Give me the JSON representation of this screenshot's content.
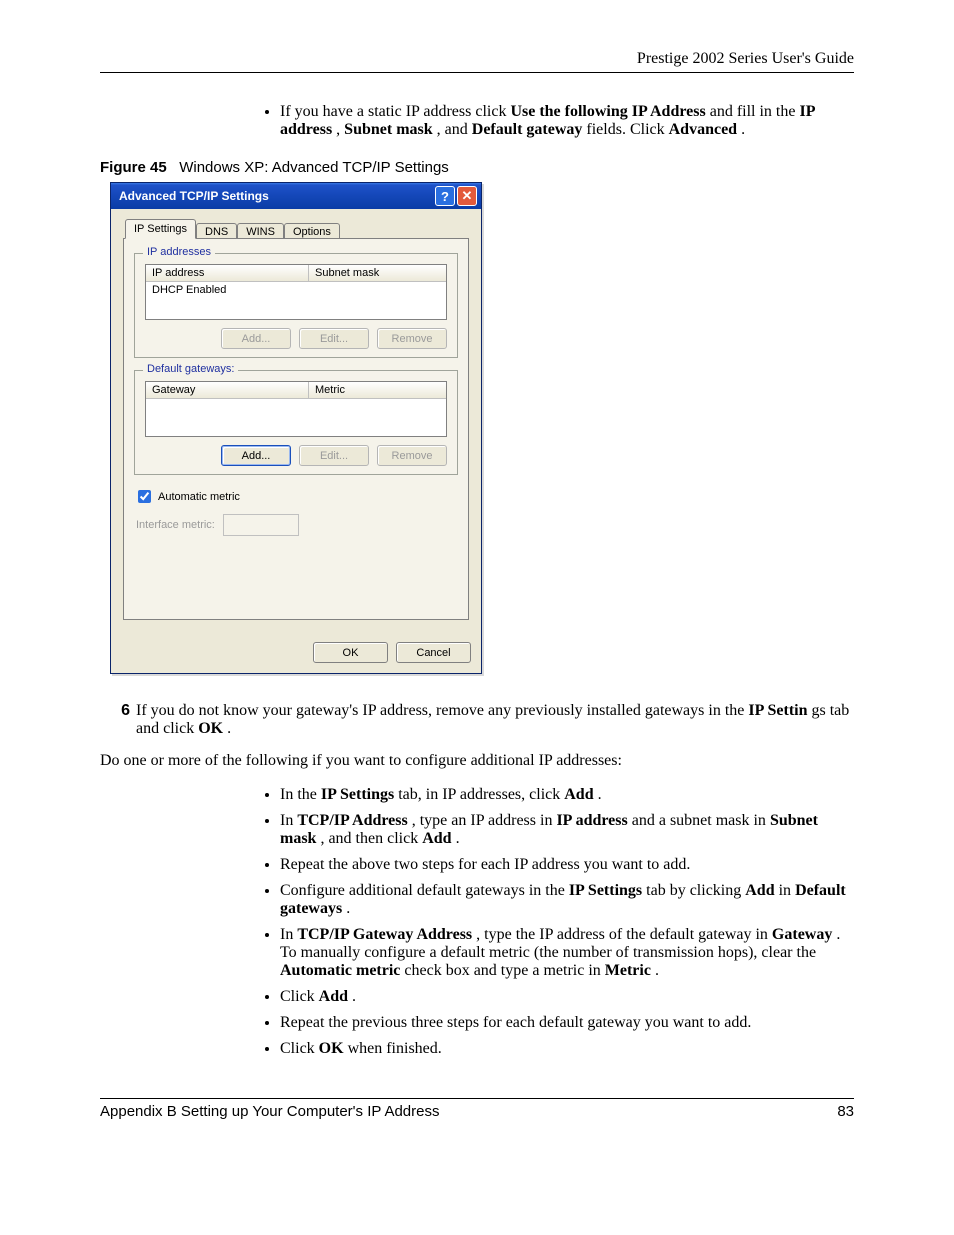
{
  "header": {
    "guide_title": "Prestige 2002 Series User's Guide"
  },
  "intro_bullet": {
    "pre": "If you have a static IP address click ",
    "b1": "Use the following IP Address",
    "mid1": " and fill in the ",
    "b2": "IP address",
    "sep1": ", ",
    "b3": "Subnet mask",
    "sep2": ", and ",
    "b4": "Default gateway",
    "mid2": " fields. Click ",
    "b5": "Advanced",
    "end": "."
  },
  "figure": {
    "label": "Figure 45",
    "caption": "Windows XP: Advanced TCP/IP Settings"
  },
  "dialog": {
    "title": "Advanced TCP/IP Settings",
    "help_glyph": "?",
    "close_glyph": "✕",
    "tabs": {
      "ip_settings": "IP Settings",
      "dns": "DNS",
      "wins": "WINS",
      "options": "Options"
    },
    "ip_group": {
      "legend": "IP addresses",
      "col_ip": "IP address",
      "col_mask": "Subnet mask",
      "row1": "DHCP Enabled",
      "add": "Add...",
      "edit": "Edit...",
      "remove": "Remove"
    },
    "gw_group": {
      "legend": "Default gateways:",
      "col_gw": "Gateway",
      "col_metric": "Metric",
      "add": "Add...",
      "edit": "Edit...",
      "remove": "Remove"
    },
    "auto_metric_label": "Automatic metric",
    "interface_metric_label": "Interface metric:",
    "ok": "OK",
    "cancel": "Cancel"
  },
  "step6": {
    "num": "6",
    "pre": "If you do not know your gateway's IP address, remove any previously installed gateways in the ",
    "b1": "IP Settin",
    "mid": "gs tab and click ",
    "b2": "OK",
    "end": "."
  },
  "para1": "Do one or more of the following if you want to configure additional IP addresses:",
  "bullets": {
    "i1": {
      "pre": "In the ",
      "b1": "IP Settings",
      "mid": " tab, in IP addresses, click ",
      "b2": "Add",
      "end": "."
    },
    "i2": {
      "pre": "In ",
      "b1": "TCP/IP Address",
      "mid1": ", type an IP address in ",
      "b2": "IP address",
      "mid2": " and a subnet mask in ",
      "b3": "Subnet mask",
      "mid3": ", and then click ",
      "b4": "Add",
      "end": "."
    },
    "i3": {
      "txt": "Repeat the above two steps for each IP address you want to add."
    },
    "i4": {
      "pre": "Configure additional default gateways in the ",
      "b1": "IP Settings",
      "mid": " tab by clicking ",
      "b2": "Add",
      "mid2": " in ",
      "b3": "Default gateways",
      "end": "."
    },
    "i5": {
      "pre": "In ",
      "b1": "TCP/IP Gateway Address",
      "mid1": ", type the IP address of the default gateway in ",
      "b2": "Gateway",
      "mid2": ". To manually configure a default metric (the number of transmission hops), clear the ",
      "b3": "Automatic metric",
      "mid3": " check box and type a metric in ",
      "b4": "Metric",
      "end": "."
    },
    "i6": {
      "pre": "Click ",
      "b1": "Add",
      "end": "."
    },
    "i7": {
      "txt": "Repeat the previous three steps for each default gateway you want to add."
    },
    "i8": {
      "pre": "Click ",
      "b1": "OK",
      "end": " when finished."
    }
  },
  "footer": {
    "appendix": "Appendix B Setting up Your Computer's IP Address",
    "page": "83"
  }
}
